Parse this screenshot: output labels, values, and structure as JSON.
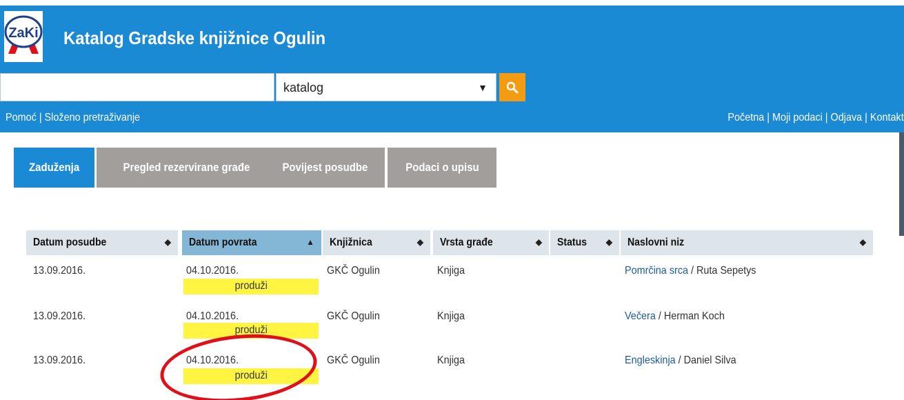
{
  "header": {
    "logo_text": "ZaKi",
    "title": "Katalog Gradske knjižnice Ogulin"
  },
  "search": {
    "query": "",
    "scope": "katalog",
    "search_icon": "search-icon"
  },
  "nav_left": [
    "Pomoć",
    "Složeno pretraživanje"
  ],
  "nav_right": [
    "Početna",
    "Moji podaci",
    "Odjava",
    "Kontakt"
  ],
  "tabs": [
    {
      "label": "Zaduženja",
      "active": true
    },
    {
      "label": "Pregled rezervirane građe",
      "active": false
    },
    {
      "label": "Povijest posudbe",
      "active": false
    },
    {
      "label": "Podaci o upisu",
      "active": false
    }
  ],
  "table": {
    "columns": [
      "Datum posudbe",
      "Datum povrata",
      "Knjižnica",
      "Vrsta građe",
      "Status",
      "Naslovni niz"
    ],
    "sorted_column": "Datum povrata",
    "extend_label": "produži",
    "rows": [
      {
        "loan_date": "13.09.2016.",
        "due_date": "04.10.2016.",
        "library": "GKČ Ogulin",
        "type": "Knjiga",
        "status": "",
        "title": "Pomrčina srca",
        "author": " / Ruta Sepetys"
      },
      {
        "loan_date": "13.09.2016.",
        "due_date": "04.10.2016.",
        "library": "GKČ Ogulin",
        "type": "Knjiga",
        "status": "",
        "title": "Večera",
        "author": " / Herman Koch"
      },
      {
        "loan_date": "13.09.2016.",
        "due_date": "04.10.2016.",
        "library": "GKČ Ogulin",
        "type": "Knjiga",
        "status": "",
        "title": "Engleskinja",
        "author": " / Daniel Silva"
      }
    ]
  },
  "colors": {
    "header_blue": "#1a8ad4",
    "tab_inactive": "#a19e9c",
    "search_button": "#f39c12",
    "extend_highlight": "#fff442",
    "annotation_circle": "#e0101a"
  }
}
